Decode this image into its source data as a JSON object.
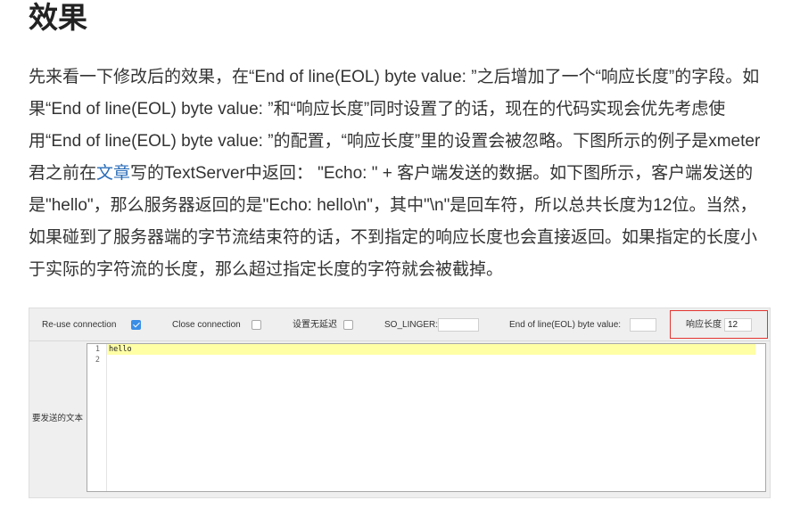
{
  "article": {
    "heading": "效果",
    "paragraph": {
      "before_link": "先来看一下修改后的效果，在“End of line(EOL) byte value: ”之后增加了一个“响应长度”的字段。如果“End of line(EOL) byte value: ”和“响应长度”同时设置了的话，现在的代码实现会优先考虑使用“End of line(EOL) byte value: ”的配置，“响应长度”里的设置会被忽略。下图所示的例子是xmeter君之前在",
      "link_text": "文章",
      "after_link": "写的TextServer中返回：  \"Echo: \" + 客户端发送的数据。如下图所示，客户端发送的是\"hello\"，那么服务器返回的是\"Echo: hello\\n\"，其中\"\\n\"是回车符，所以总共长度为12位。当然，如果碰到了服务器端的字节流结束符的话，不到指定的响应长度也会直接返回。如果指定的长度小于实际的字符流的长度，那么超过指定长度的字符就会被截掉。"
    }
  },
  "panel": {
    "options": {
      "reuse_connection": {
        "label": "Re-use connection",
        "checked": true,
        "icon": "check-icon"
      },
      "close_connection": {
        "label": "Close connection",
        "checked": false
      },
      "no_delay": {
        "label": "设置无延迟",
        "checked": false
      },
      "so_linger": {
        "label": "SO_LINGER:",
        "value": ""
      },
      "eol_byte": {
        "label": "End of line(EOL) byte value:",
        "value": ""
      },
      "response_length": {
        "label": "响应长度",
        "value": "12"
      }
    },
    "text_label": "要发送的文本",
    "editor": {
      "line_numbers": [
        "1",
        "2"
      ],
      "lines": [
        "hello",
        ""
      ]
    }
  },
  "colors": {
    "link": "#2a6db8",
    "highlight_border": "#e3342f",
    "checkbox_checked": "#3a8ee6",
    "editor_current_line": "#ffffa6"
  }
}
